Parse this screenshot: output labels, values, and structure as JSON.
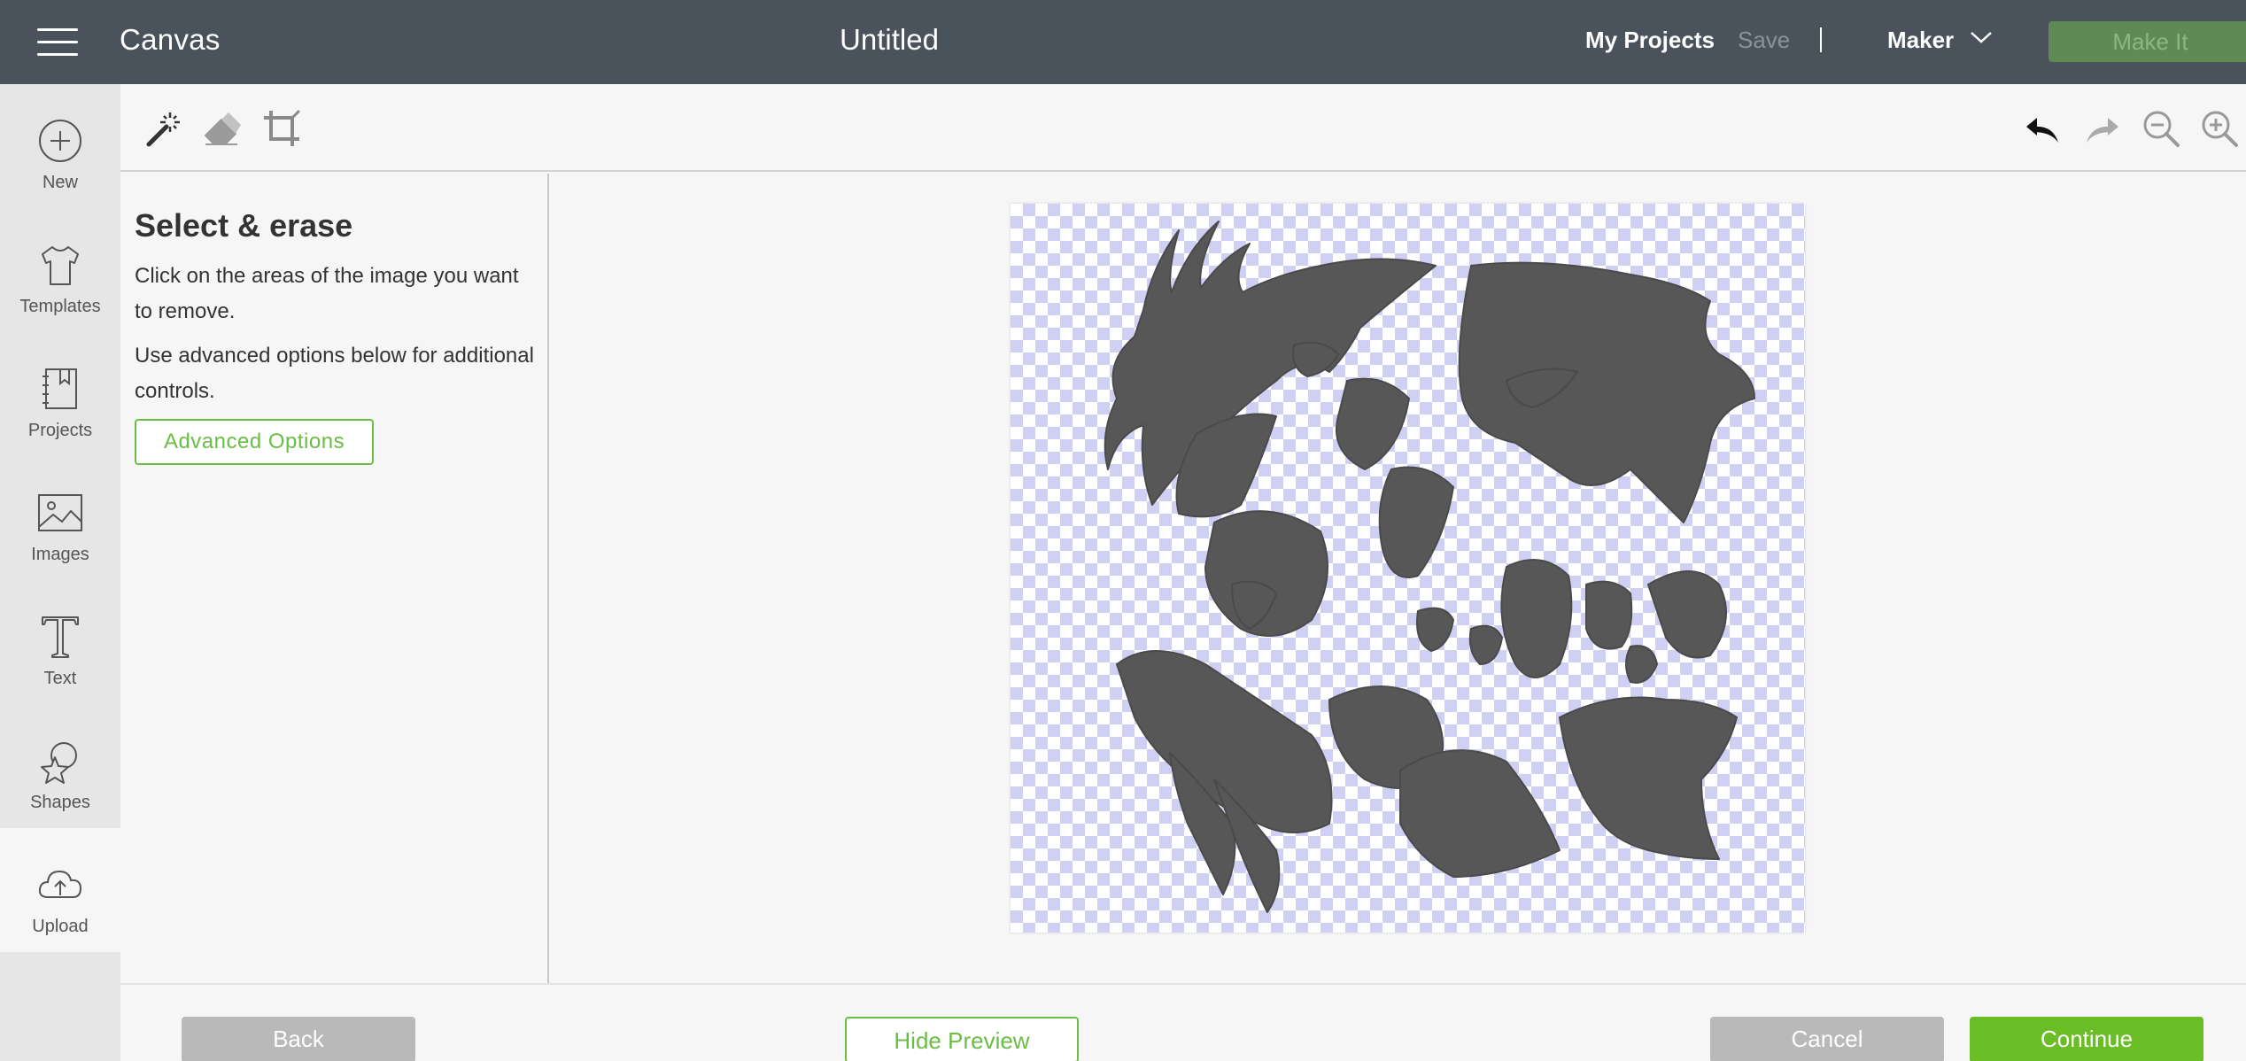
{
  "topbar": {
    "menu_icon": "hamburger-menu-icon",
    "app_title": "Canvas",
    "doc_title": "Untitled",
    "my_projects": "My Projects",
    "save": "Save",
    "machine": "Maker",
    "make_it": "Make It"
  },
  "leftnav": {
    "items": [
      {
        "label": "New",
        "icon": "plus-circle-icon"
      },
      {
        "label": "Templates",
        "icon": "tshirt-icon"
      },
      {
        "label": "Projects",
        "icon": "notebook-icon"
      },
      {
        "label": "Images",
        "icon": "image-icon"
      },
      {
        "label": "Text",
        "icon": "text-t-icon"
      },
      {
        "label": "Shapes",
        "icon": "shapes-icon"
      },
      {
        "label": "Upload",
        "icon": "cloud-upload-icon"
      }
    ]
  },
  "toolbar": {
    "tools": [
      "magic-wand-icon",
      "eraser-icon",
      "crop-icon"
    ],
    "actions": [
      "undo-icon",
      "redo-icon",
      "zoom-out-icon",
      "zoom-in-icon"
    ]
  },
  "panel": {
    "title": "Select & erase",
    "text1": "Click on the areas of the image you want to remove.",
    "text2": "Use advanced options below for additional controls.",
    "advanced_button": "Advanced Options"
  },
  "bottombar": {
    "back": "Back",
    "hide_preview": "Hide Preview",
    "cancel": "Cancel",
    "continue": "Continue"
  },
  "colors": {
    "topbar": "#4a535b",
    "accent_green": "#6abd45",
    "continue_green": "#6abd24",
    "checker": "#d0d0f5",
    "image_fill": "#555555"
  }
}
